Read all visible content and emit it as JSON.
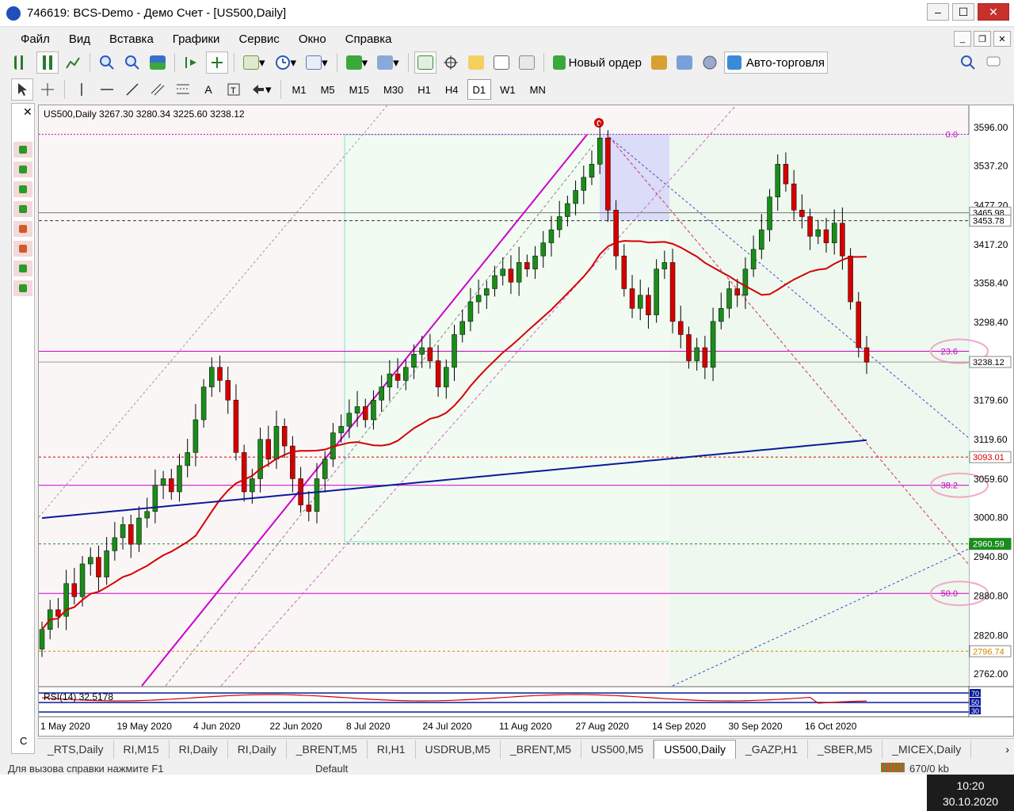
{
  "window": {
    "title": "746619: BCS-Demo - Демо Счет - [US500,Daily]",
    "buttons": {
      "minimize": "–",
      "maximize": "☐",
      "close": "✕"
    }
  },
  "menu": [
    "Файл",
    "Вид",
    "Вставка",
    "Графики",
    "Сервис",
    "Окно",
    "Справка"
  ],
  "toolbar1": {
    "new_order": "Новый ордер",
    "auto_trading": "Авто-торговля"
  },
  "toolbar2": {
    "text_tool": "A",
    "timeframes": [
      "M1",
      "M5",
      "M15",
      "M30",
      "H1",
      "H4",
      "D1",
      "W1",
      "MN"
    ],
    "active_timeframe": "D1"
  },
  "chart": {
    "info": "US500,Daily  3267.30 3280.34 3225.60 3238.12",
    "fibo_marker": "0",
    "fibo_levels": [
      {
        "label": "0.0",
        "price": 3585.5
      },
      {
        "label": "23.6",
        "price": 3254.5
      },
      {
        "label": "38.2",
        "price": 3050
      },
      {
        "label": "50.0",
        "price": 2885
      }
    ],
    "price_axis": [
      "3596.00",
      "3537.20",
      "3477.20",
      "3417.20",
      "3358.40",
      "3298.40",
      "3238.12",
      "3179.60",
      "3119.60",
      "3059.60",
      "3000.80",
      "2940.80",
      "2880.80",
      "2820.80",
      "2762.00"
    ],
    "price_tags": [
      {
        "label": "3465.98",
        "price": 3465.98,
        "bg": "#ffffff",
        "color": "#000000"
      },
      {
        "label": "3453.78",
        "price": 3453.78,
        "bg": "#ffffff",
        "color": "#000000"
      },
      {
        "label": "3238.12",
        "price": 3238.12,
        "bg": "#ffffff",
        "color": "#000000"
      },
      {
        "label": "3093.01",
        "price": 3093.01,
        "bg": "#ffffff",
        "color": "#d40000"
      },
      {
        "label": "2960.59",
        "price": 2960.59,
        "bg": "#1a8c1a",
        "color": "#ffffff"
      },
      {
        "label": "2796.74",
        "price": 2796.74,
        "bg": "#ffffff",
        "color": "#d08a00"
      }
    ],
    "date_axis": [
      "1 May 2020",
      "19 May 2020",
      "4 Jun 2020",
      "22 Jun 2020",
      "8 Jul 2020",
      "24 Jul 2020",
      "11 Aug 2020",
      "27 Aug 2020",
      "14 Sep 2020",
      "30 Sep 2020",
      "16 Oct 2020"
    ],
    "rsi_label": "RSI(14) 32.5178",
    "rsi_axis": [
      "70",
      "50",
      "30"
    ],
    "colors": {
      "bull": "#1a8c1a",
      "bear": "#d40000",
      "ma_fast": "#d40000",
      "ma_slow": "#0a1a9a",
      "fibo": "#cc00cc"
    }
  },
  "tabs": [
    "_RTS,Daily",
    "RI,M15",
    "RI,Daily",
    "RI,Daily",
    "_BRENT,M5",
    "RI,H1",
    "USDRUB,M5",
    "_BRENT,M5",
    "US500,M5",
    "US500,Daily",
    "_GAZP,H1",
    "_SBER,M5",
    "_MICEX,Daily"
  ],
  "active_tab": "US500,Daily",
  "status": {
    "help": "Для вызова справки нажмите F1",
    "profile": "Default",
    "traffic": "670/0 kb"
  },
  "clock": {
    "time": "10:20",
    "date": "30.10.2020"
  },
  "nav_left": {
    "bottom": "C"
  }
}
